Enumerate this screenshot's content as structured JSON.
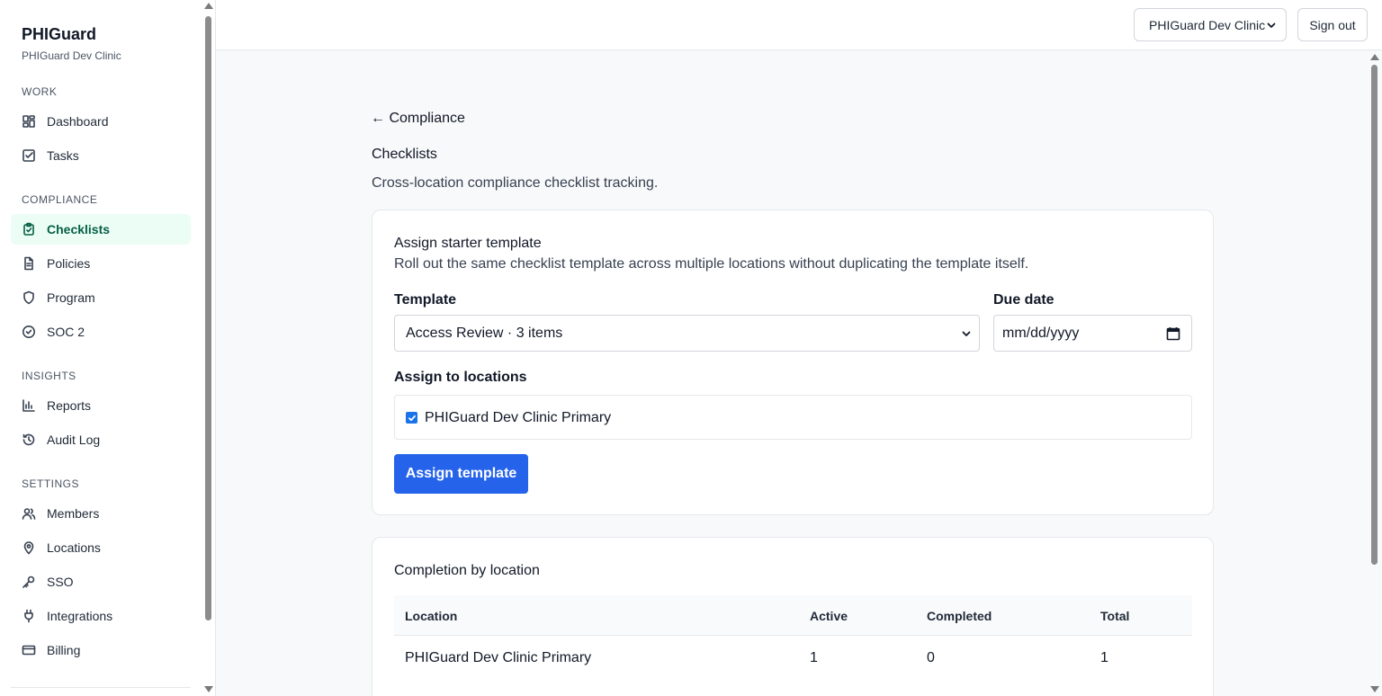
{
  "sidebar": {
    "brand_title": "PHIGuard",
    "brand_subtitle": "PHIGuard Dev Clinic",
    "sections": {
      "work": "WORK",
      "compliance": "COMPLIANCE",
      "insights": "INSIGHTS",
      "settings": "SETTINGS"
    },
    "items": {
      "dashboard": "Dashboard",
      "tasks": "Tasks",
      "checklists": "Checklists",
      "policies": "Policies",
      "program": "Program",
      "soc2": "SOC 2",
      "reports": "Reports",
      "audit_log": "Audit Log",
      "members": "Members",
      "locations": "Locations",
      "sso": "SSO",
      "integrations": "Integrations",
      "billing": "Billing"
    },
    "active_item": "checklists"
  },
  "header": {
    "org_selected": "PHIGuard Dev Clinic",
    "sign_out": "Sign out"
  },
  "page": {
    "back_link": "← Compliance",
    "title": "Checklists",
    "description": "Cross-location compliance checklist tracking."
  },
  "assign_card": {
    "title": "Assign starter template",
    "description": "Roll out the same checklist template across multiple locations without duplicating the template itself.",
    "template_label": "Template",
    "template_selected": "Access Review · 3 items",
    "due_date_label": "Due date",
    "due_date_placeholder": "mm/dd/yyyy",
    "locations_label": "Assign to locations",
    "locations": [
      {
        "name": "PHIGuard Dev Clinic Primary",
        "checked": true
      }
    ],
    "assign_button": "Assign template"
  },
  "completion_card": {
    "title": "Completion by location",
    "columns": [
      "Location",
      "Active",
      "Completed",
      "Total"
    ],
    "rows": [
      [
        "PHIGuard Dev Clinic Primary",
        "1",
        "0",
        "1"
      ]
    ]
  },
  "colors": {
    "primary_button": "#2563eb",
    "active_nav_bg": "#ecfdf5",
    "active_nav_text": "#065f46",
    "checkbox": "#1a73e8"
  }
}
